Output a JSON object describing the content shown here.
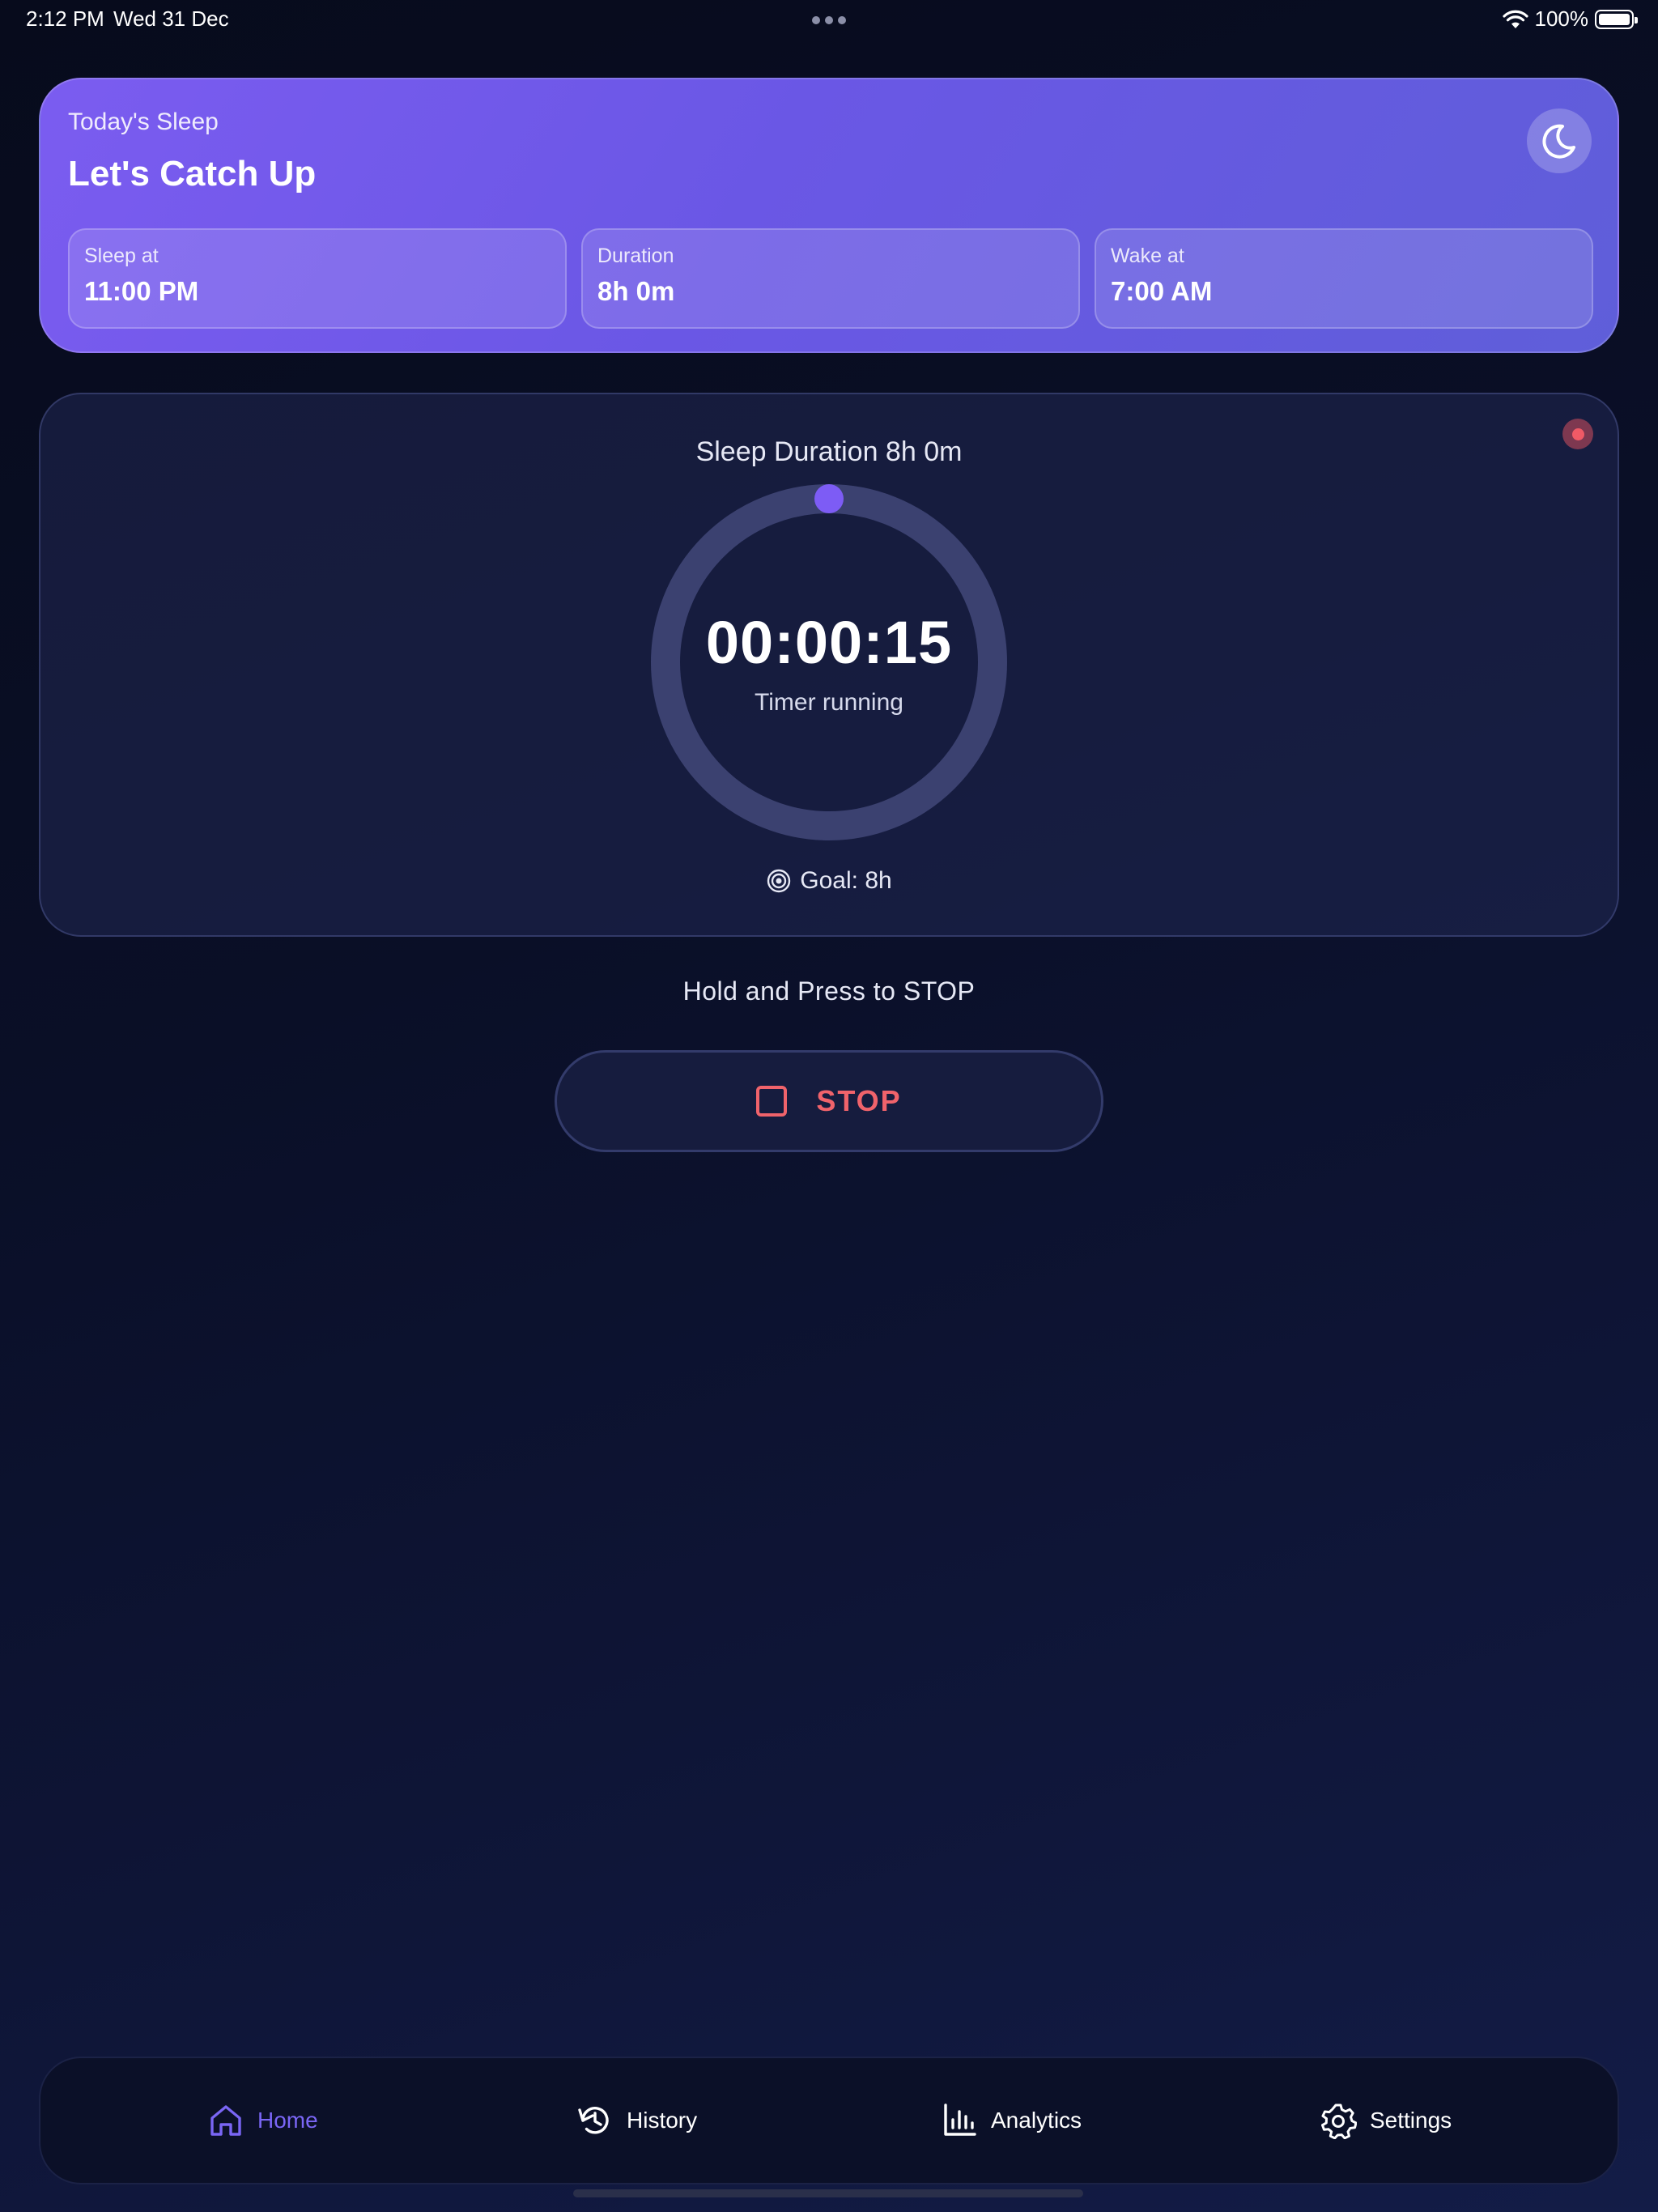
{
  "status_bar": {
    "time": "2:12 PM",
    "date": "Wed 31 Dec",
    "battery": "100%"
  },
  "header": {
    "subtitle": "Today's Sleep",
    "title": "Let's Catch Up",
    "stats": [
      {
        "label": "Sleep at",
        "value": "11:00 PM"
      },
      {
        "label": "Duration",
        "value": "8h 0m"
      },
      {
        "label": "Wake at",
        "value": "7:00 AM"
      }
    ]
  },
  "timer": {
    "duration_label": "Sleep Duration 8h 0m",
    "elapsed": "00:00:15",
    "status": "Timer running",
    "goal": "Goal: 8h",
    "progress": 0.0
  },
  "hold_hint": "Hold and Press to STOP",
  "stop_button": {
    "label": "STOP"
  },
  "nav": {
    "items": [
      {
        "label": "Home",
        "icon": "home-icon",
        "active": true
      },
      {
        "label": "History",
        "icon": "history-icon",
        "active": false
      },
      {
        "label": "Analytics",
        "icon": "analytics-icon",
        "active": false
      },
      {
        "label": "Settings",
        "icon": "settings-icon",
        "active": false
      }
    ]
  },
  "colors": {
    "accent": "#7a66f5",
    "header_gradient_start": "#7b5cf0",
    "header_gradient_end": "#5f5ed9",
    "stop": "#f0636b",
    "ring_track": "#3b4170",
    "ring_knob": "#7d5cf5",
    "record_indicator": "#f05a66"
  }
}
